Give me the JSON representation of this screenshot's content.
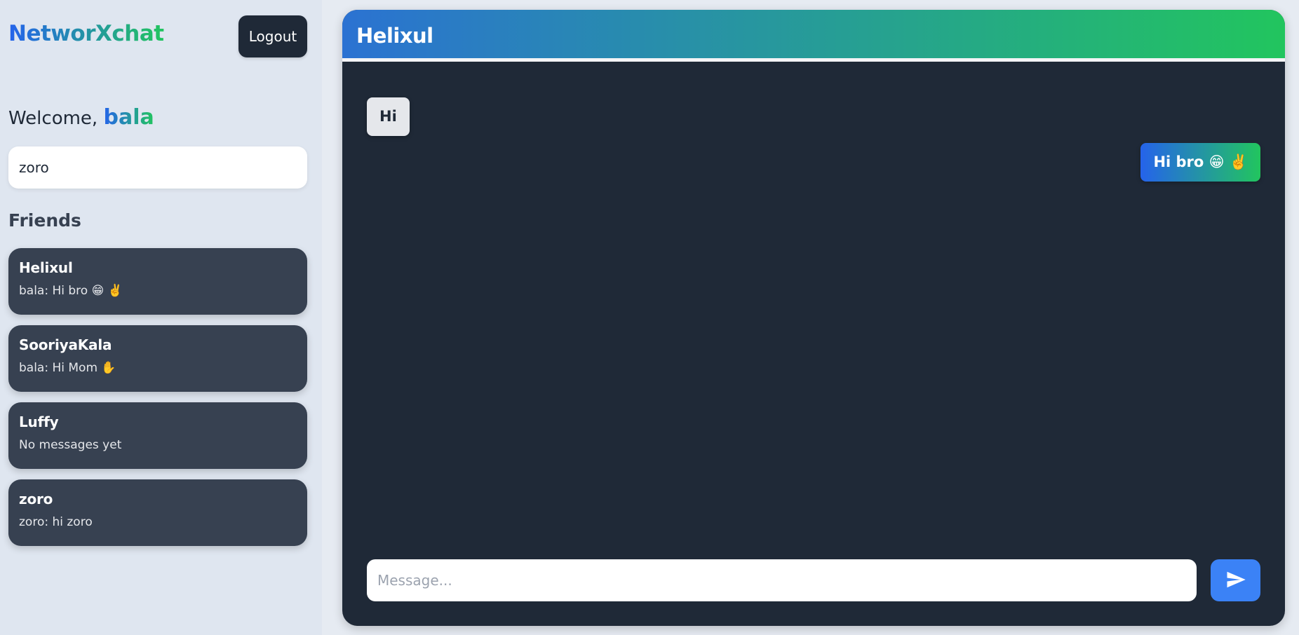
{
  "app": {
    "brand": "NetworXchat",
    "logout_label": "Logout"
  },
  "welcome": {
    "prefix": "Welcome,",
    "username": "bala"
  },
  "search": {
    "value": "zoro"
  },
  "friends": {
    "heading": "Friends",
    "items": [
      {
        "name": "Helixul",
        "preview": "bala: Hi bro 😁 ✌️"
      },
      {
        "name": "SooriyaKala",
        "preview": "bala: Hi Mom ✋"
      },
      {
        "name": "Luffy",
        "preview": "No messages yet"
      },
      {
        "name": "zoro",
        "preview": "zoro: hi zoro"
      }
    ]
  },
  "chat": {
    "title": "Helixul",
    "messages": [
      {
        "direction": "incoming",
        "text": "Hi"
      },
      {
        "direction": "outgoing",
        "text": "Hi bro 😁 ✌️"
      }
    ],
    "input_placeholder": "Message...",
    "send_icon": "send-icon"
  },
  "colors": {
    "brand_gradient_start": "#2563eb",
    "brand_gradient_end": "#22c55e",
    "sidebar_bg": "#dfe6f0",
    "chat_bg": "#1f2937",
    "friend_card_bg": "#374151",
    "send_button": "#3b82f6"
  }
}
